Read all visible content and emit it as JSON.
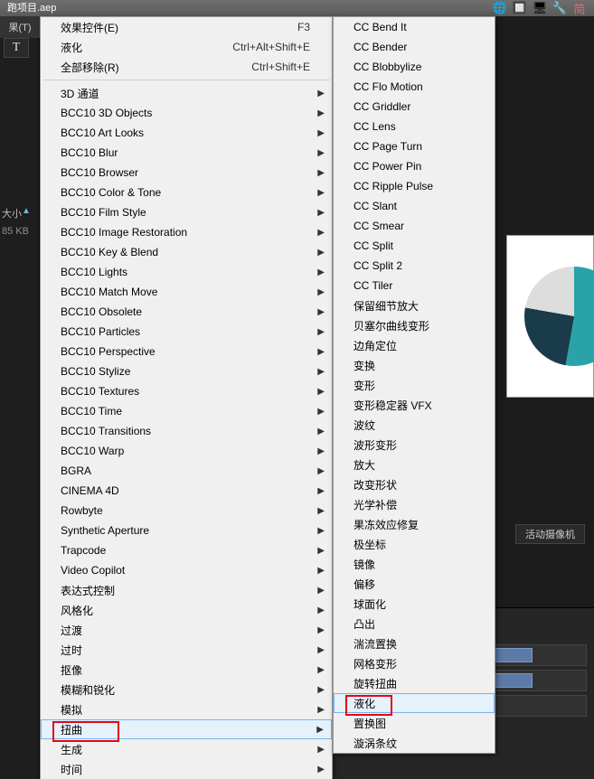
{
  "titlebar": {
    "filename": "跑项目.aep"
  },
  "toolbar": {
    "icons": [
      "🌐",
      "🔲",
      "🖥",
      "🔧",
      "简"
    ]
  },
  "leftPanel": {
    "tab": "果(T)",
    "typeTool": "T",
    "sizeHeader": "大小",
    "size": "85 KB"
  },
  "indicator": "▲",
  "menu1": {
    "items": [
      {
        "label": "效果控件(E)",
        "shortcut": "F3"
      },
      {
        "label": "液化",
        "shortcut": "Ctrl+Alt+Shift+E"
      },
      {
        "label": "全部移除(R)",
        "shortcut": "Ctrl+Shift+E"
      },
      {
        "sep": true
      },
      {
        "label": "3D 通道",
        "arrow": true
      },
      {
        "label": "BCC10 3D Objects",
        "arrow": true
      },
      {
        "label": "BCC10 Art Looks",
        "arrow": true
      },
      {
        "label": "BCC10 Blur",
        "arrow": true
      },
      {
        "label": "BCC10 Browser",
        "arrow": true
      },
      {
        "label": "BCC10 Color & Tone",
        "arrow": true
      },
      {
        "label": "BCC10 Film Style",
        "arrow": true
      },
      {
        "label": "BCC10 Image Restoration",
        "arrow": true
      },
      {
        "label": "BCC10 Key & Blend",
        "arrow": true
      },
      {
        "label": "BCC10 Lights",
        "arrow": true
      },
      {
        "label": "BCC10 Match Move",
        "arrow": true
      },
      {
        "label": "BCC10 Obsolete",
        "arrow": true
      },
      {
        "label": "BCC10 Particles",
        "arrow": true
      },
      {
        "label": "BCC10 Perspective",
        "arrow": true
      },
      {
        "label": "BCC10 Stylize",
        "arrow": true
      },
      {
        "label": "BCC10 Textures",
        "arrow": true
      },
      {
        "label": "BCC10 Time",
        "arrow": true
      },
      {
        "label": "BCC10 Transitions",
        "arrow": true
      },
      {
        "label": "BCC10 Warp",
        "arrow": true
      },
      {
        "label": "BGRA",
        "arrow": true
      },
      {
        "label": "CINEMA 4D",
        "arrow": true
      },
      {
        "label": "Rowbyte",
        "arrow": true
      },
      {
        "label": "Synthetic Aperture",
        "arrow": true
      },
      {
        "label": "Trapcode",
        "arrow": true
      },
      {
        "label": "Video Copilot",
        "arrow": true
      },
      {
        "label": "表达式控制",
        "arrow": true
      },
      {
        "label": "风格化",
        "arrow": true
      },
      {
        "label": "过渡",
        "arrow": true
      },
      {
        "label": "过时",
        "arrow": true
      },
      {
        "label": "抠像",
        "arrow": true
      },
      {
        "label": "模糊和锐化",
        "arrow": true
      },
      {
        "label": "模拟",
        "arrow": true
      },
      {
        "label": "扭曲",
        "arrow": true,
        "highlight": true,
        "redbox": "m1"
      },
      {
        "label": "生成",
        "arrow": true
      },
      {
        "label": "时间",
        "arrow": true
      }
    ]
  },
  "menu2": {
    "items": [
      {
        "label": "CC Bend It"
      },
      {
        "label": "CC Bender"
      },
      {
        "label": "CC Blobbylize"
      },
      {
        "label": "CC Flo Motion"
      },
      {
        "label": "CC Griddler"
      },
      {
        "label": "CC Lens"
      },
      {
        "label": "CC Page Turn"
      },
      {
        "label": "CC Power Pin"
      },
      {
        "label": "CC Ripple Pulse"
      },
      {
        "label": "CC Slant"
      },
      {
        "label": "CC Smear"
      },
      {
        "label": "CC Split"
      },
      {
        "label": "CC Split 2"
      },
      {
        "label": "CC Tiler"
      },
      {
        "label": "保留细节放大"
      },
      {
        "label": "贝塞尔曲线变形"
      },
      {
        "label": "边角定位"
      },
      {
        "label": "变换"
      },
      {
        "label": "变形"
      },
      {
        "label": "变形稳定器 VFX"
      },
      {
        "label": "波纹"
      },
      {
        "label": "波形变形"
      },
      {
        "label": "放大"
      },
      {
        "label": "改变形状"
      },
      {
        "label": "光学补偿"
      },
      {
        "label": "果冻效应修复"
      },
      {
        "label": "极坐标"
      },
      {
        "label": "镜像"
      },
      {
        "label": "偏移"
      },
      {
        "label": "球面化"
      },
      {
        "label": "凸出"
      },
      {
        "label": "湍流置换"
      },
      {
        "label": "网格变形"
      },
      {
        "label": "旋转扭曲"
      },
      {
        "label": "液化",
        "highlight": true,
        "redbox": "m2"
      },
      {
        "label": "置换图"
      },
      {
        "label": "漩涡条纹"
      }
    ]
  },
  "viewer": {
    "cameraBtn": "活动摄像机"
  }
}
